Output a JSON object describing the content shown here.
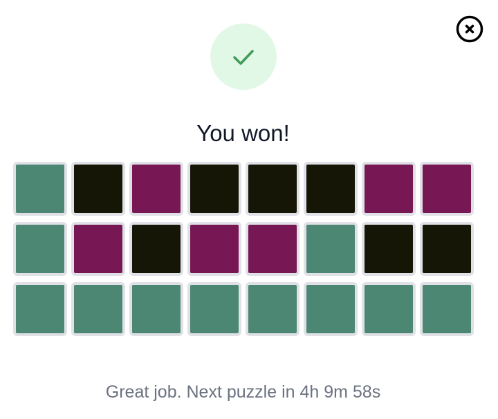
{
  "modal": {
    "title": "You won!",
    "message": "Great job. Next puzzle in 4h 9m 58s",
    "close_icon": "close-icon",
    "success_icon": "checkmark-icon"
  },
  "colors": {
    "green": "#4c8773",
    "black": "#161606",
    "purple": "#771855",
    "success_bg": "#e2f8e6",
    "success_check": "#3f9b57"
  },
  "board": {
    "rows": [
      [
        "green",
        "black",
        "purple",
        "black",
        "black",
        "black",
        "purple",
        "purple"
      ],
      [
        "green",
        "purple",
        "black",
        "purple",
        "purple",
        "green",
        "black",
        "black"
      ],
      [
        "green",
        "green",
        "green",
        "green",
        "green",
        "green",
        "green",
        "green"
      ]
    ]
  }
}
